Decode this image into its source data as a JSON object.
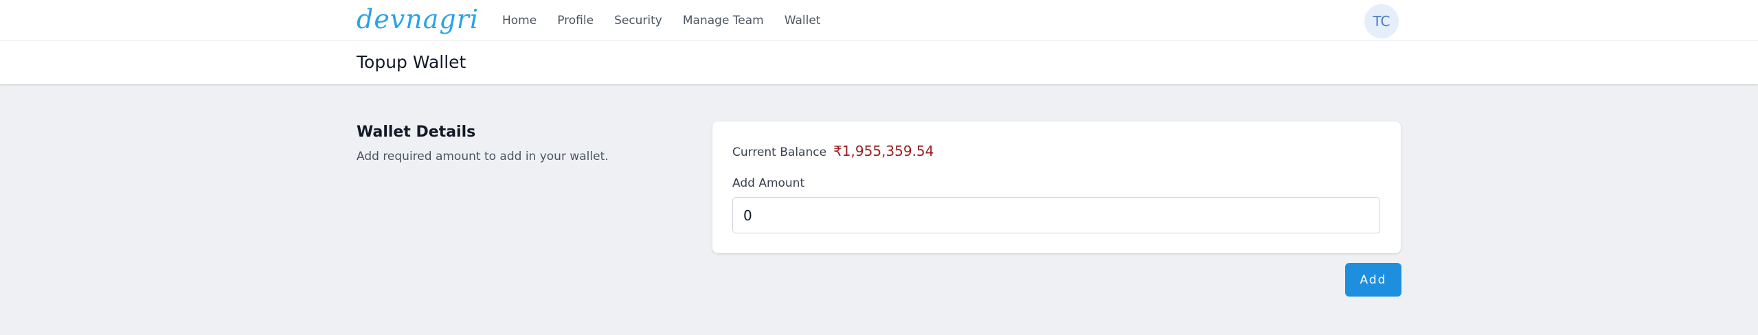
{
  "brand": {
    "logo_text": "devnagri",
    "logo_color": "#29a3e8"
  },
  "nav": {
    "links": [
      {
        "label": "Home"
      },
      {
        "label": "Profile"
      },
      {
        "label": "Security"
      },
      {
        "label": "Manage Team"
      },
      {
        "label": "Wallet"
      }
    ],
    "avatar_initials": "TC"
  },
  "page": {
    "title": "Topup Wallet"
  },
  "wallet": {
    "section_title": "Wallet Details",
    "section_description": "Add required amount to add in your wallet.",
    "balance_label": "Current Balance",
    "balance_value": "₹1,955,359.54",
    "balance_color": "#9b1c1c",
    "amount_label": "Add Amount",
    "amount_value": "0",
    "add_button_label": "Add",
    "accent_color": "#1e8fdf"
  }
}
